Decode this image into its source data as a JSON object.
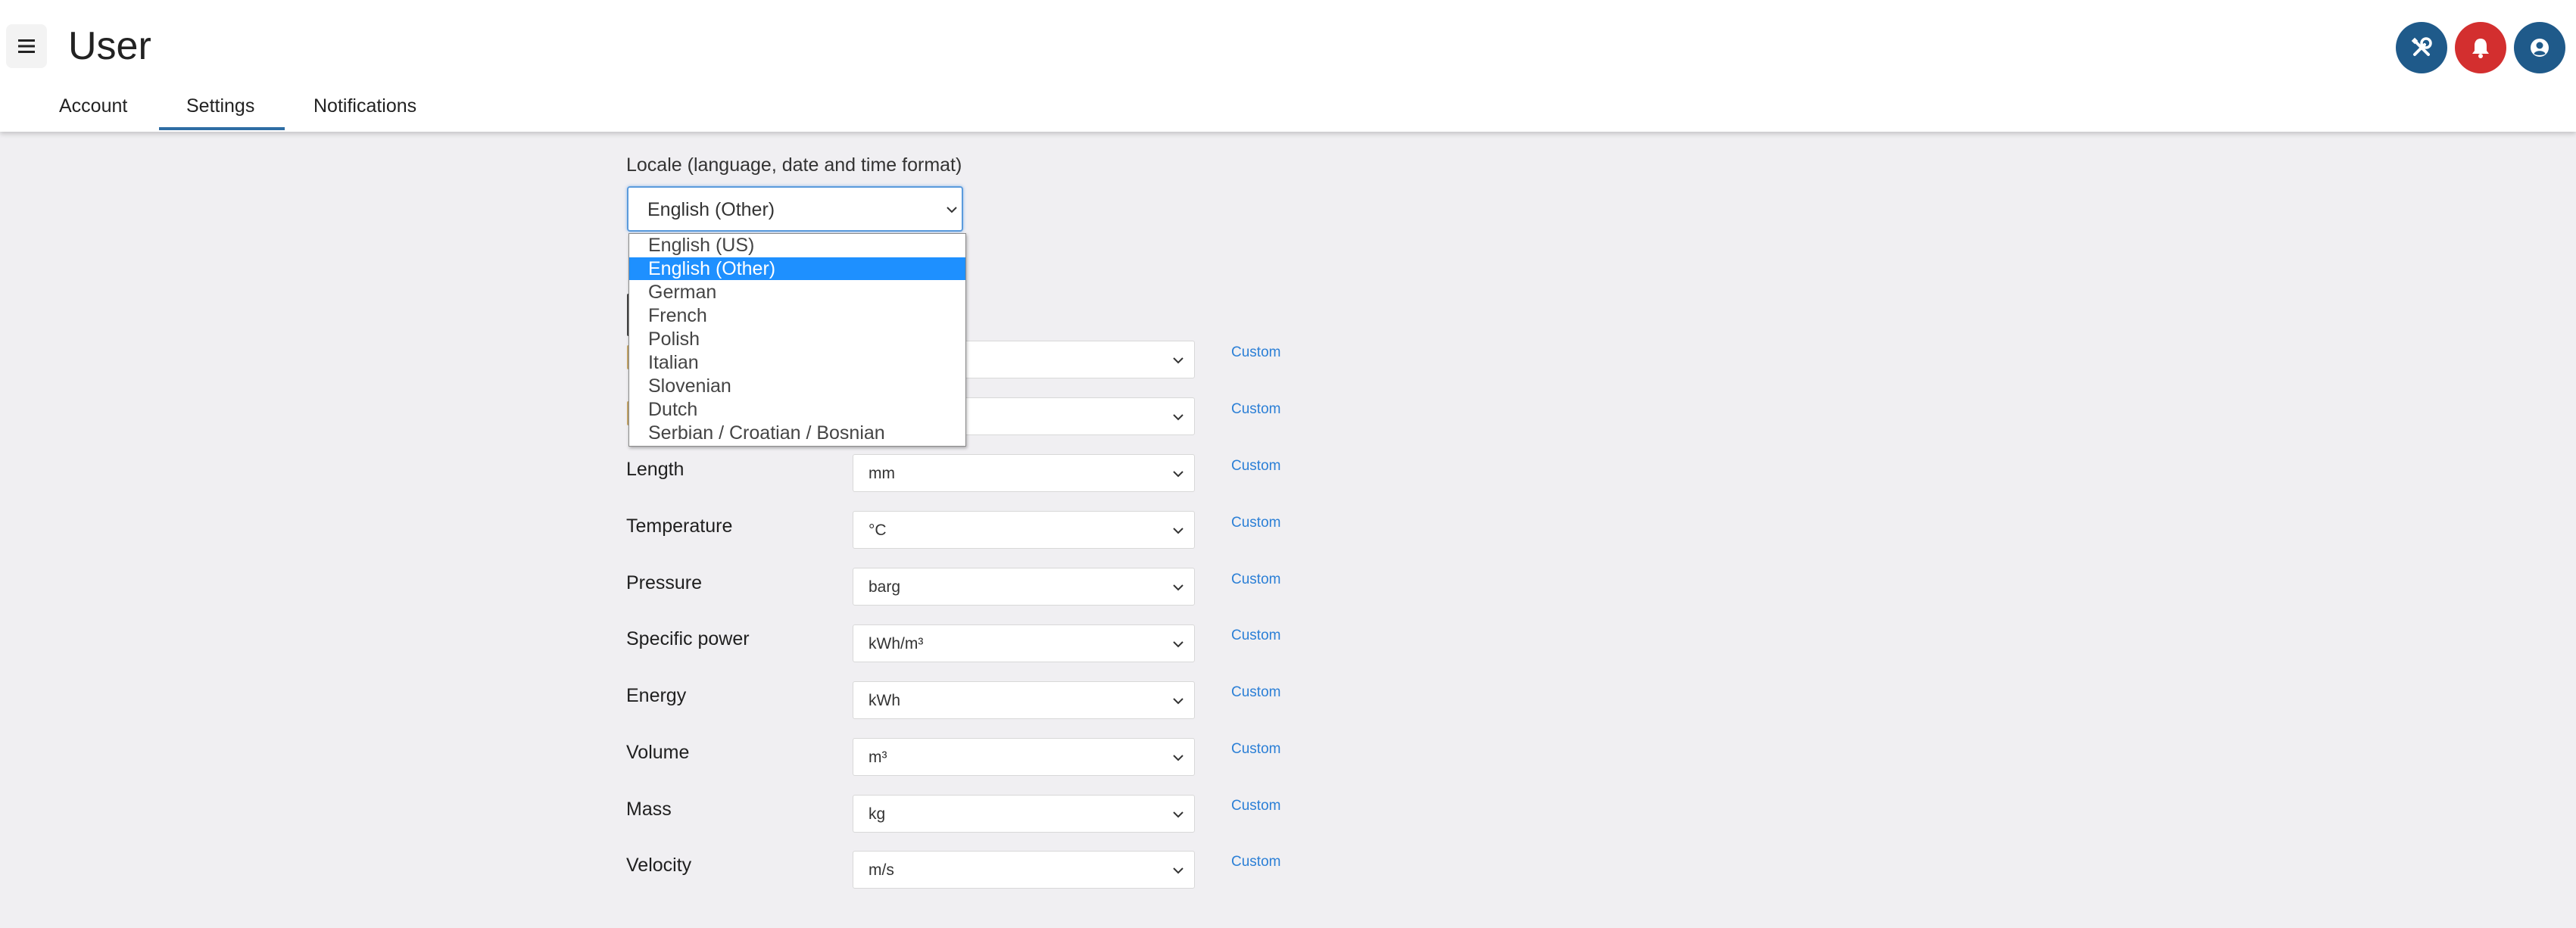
{
  "header": {
    "title": "User",
    "menu_icon": "hamburger-icon",
    "tabs": [
      {
        "label": "Account"
      },
      {
        "label": "Settings"
      },
      {
        "label": "Notifications"
      }
    ],
    "active_tab": "Settings",
    "actions": [
      {
        "icon": "tools-icon",
        "color": "#1f5a8a"
      },
      {
        "icon": "bell-icon",
        "color": "#d32f2f"
      },
      {
        "icon": "user-icon",
        "color": "#1f5a8a"
      }
    ]
  },
  "locale": {
    "label": "Locale (language, date and time format)",
    "selected": "English (Other)",
    "options": [
      "English (US)",
      "English (Other)",
      "German",
      "French",
      "Polish",
      "Italian",
      "Slovenian",
      "Dutch",
      "Serbian / Croatian / Bosnian"
    ],
    "highlight_color": "#1e90ff"
  },
  "units": {
    "custom_label": "Custom",
    "rows": [
      {
        "label": "",
        "value": ""
      },
      {
        "label": "",
        "value": ""
      },
      {
        "label": "Length",
        "value": "mm"
      },
      {
        "label": "Temperature",
        "value": "°C"
      },
      {
        "label": "Pressure",
        "value": "barg"
      },
      {
        "label": "Specific power",
        "value": "kWh/m³"
      },
      {
        "label": "Energy",
        "value": "kWh"
      },
      {
        "label": "Volume",
        "value": "m³"
      },
      {
        "label": "Mass",
        "value": "kg"
      },
      {
        "label": "Velocity",
        "value": "m/s"
      }
    ]
  },
  "colors": {
    "link": "#2b7fd6",
    "tab_underline": "#2e6da4",
    "background": "#f0eff2"
  }
}
